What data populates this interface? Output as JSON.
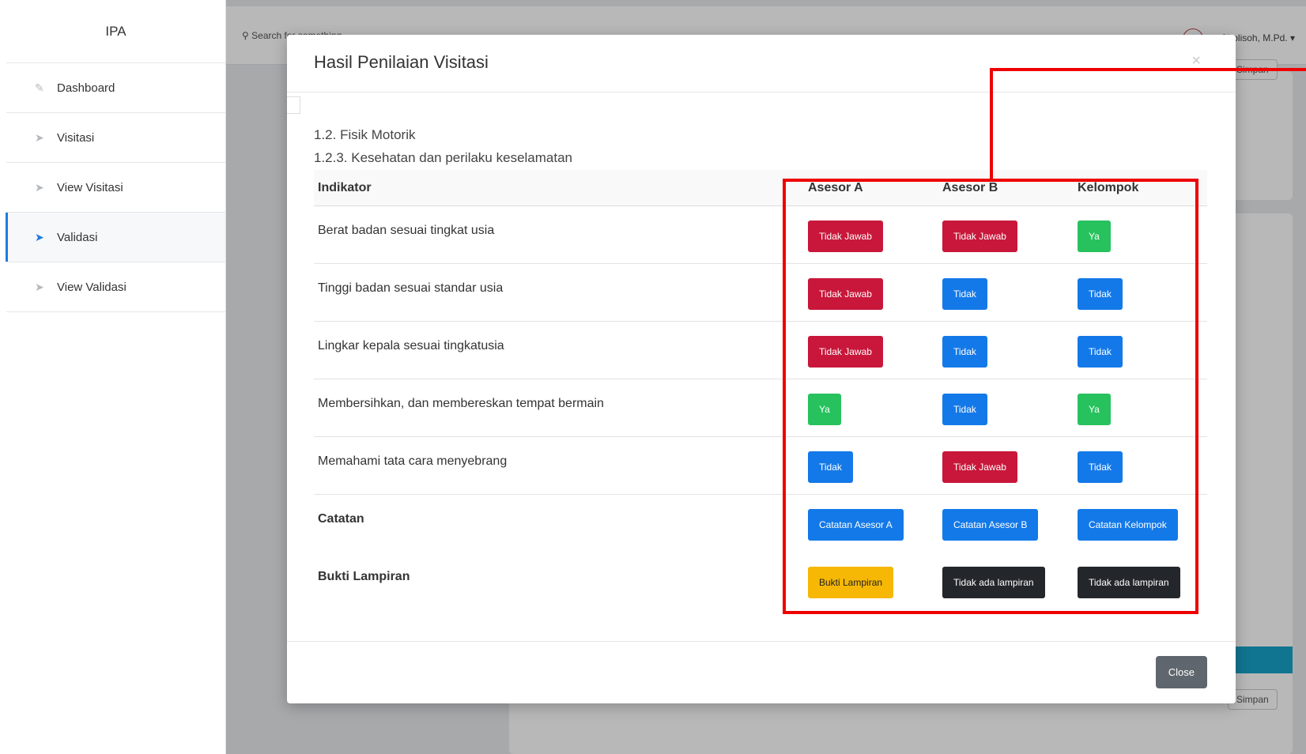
{
  "sidebar": {
    "brand": "IPA",
    "items": [
      {
        "label": "Dashboard"
      },
      {
        "label": "Visitasi"
      },
      {
        "label": "View Visitasi"
      },
      {
        "label": "Validasi"
      },
      {
        "label": "View Validasi"
      }
    ]
  },
  "topbar": {
    "search_placeholder": "Search for something...",
    "user_name": "... Sholisoh, M.Pd.",
    "save_label": "Simpan"
  },
  "modal": {
    "title": "Hasil Penilaian Visitasi",
    "close_x": "×",
    "section": "1.2. Fisik Motorik",
    "subsection": "1.2.3. Kesehatan dan perilaku keselamatan",
    "headers": [
      "Indikator",
      "Asesor A",
      "Asesor B",
      "Kelompok"
    ],
    "rows": [
      {
        "indikator": "Berat badan sesuai tingkat usia",
        "a": "Tidak Jawab",
        "b": "Tidak Jawab",
        "k": "Ya"
      },
      {
        "indikator": "Tinggi badan sesuai standar usia",
        "a": "Tidak Jawab",
        "b": "Tidak",
        "k": "Tidak"
      },
      {
        "indikator": "Lingkar kepala sesuai tingkatusia",
        "a": "Tidak Jawab",
        "b": "Tidak",
        "k": "Tidak"
      },
      {
        "indikator": "Membersihkan, dan membereskan tempat bermain",
        "a": "Ya",
        "b": "Tidak",
        "k": "Ya"
      },
      {
        "indikator": "Memahami tata cara menyebrang",
        "a": "Tidak",
        "b": "Tidak Jawab",
        "k": "Tidak"
      }
    ],
    "catatan": {
      "label": "Catatan",
      "a": "Catatan Asesor A",
      "b": "Catatan Asesor B",
      "k": "Catatan Kelompok"
    },
    "bukti": {
      "label": "Bukti Lampiran",
      "a": "Bukti Lampiran",
      "b": "Tidak ada lampiran",
      "k": "Tidak ada lampiran"
    },
    "close_label": "Close"
  },
  "colors": {
    "tidak_jawab": "#c8173a",
    "ya": "#27c25d",
    "tidak": "#1479e8",
    "bukti": "#f6b804",
    "no_attachment": "#23262a",
    "highlight": "#ee0000"
  }
}
